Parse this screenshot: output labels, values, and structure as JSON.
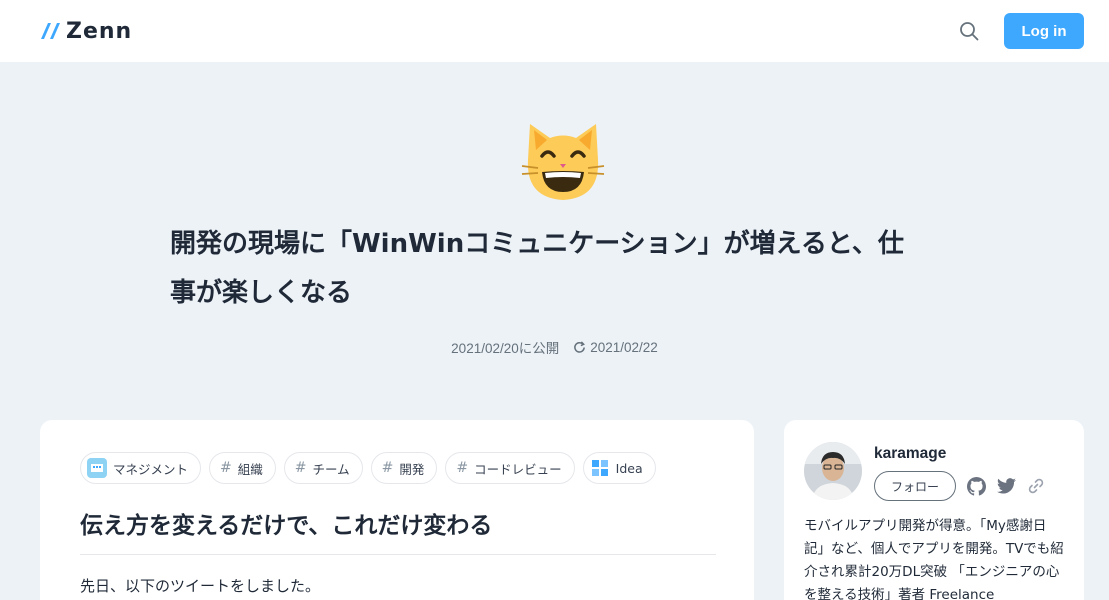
{
  "header": {
    "logo_text": "Zenn",
    "login_label": "Log in"
  },
  "article": {
    "emoji": "cat-face-with-smile",
    "title_line1": "開発の現場に「WinWinコミュニケーション」が増えると、仕",
    "title_line2": "事が楽しくなる",
    "published": "2021/02/20に公開",
    "updated": "2021/02/22",
    "topics": [
      {
        "label": "マネジメント",
        "icon": "management-icon"
      },
      {
        "label": "組織",
        "icon": "hash"
      },
      {
        "label": "チーム",
        "icon": "hash"
      },
      {
        "label": "開発",
        "icon": "hash"
      },
      {
        "label": "コードレビュー",
        "icon": "hash"
      },
      {
        "label": "Idea",
        "icon": "idea-icon"
      }
    ],
    "heading": "伝え方を変えるだけで、これだけ変わる",
    "body_first": "先日、以下のツイートをしました。"
  },
  "author": {
    "name": "karamage",
    "follow_label": "フォロー",
    "bio": "モバイルアプリ開発が得意。「My感謝日記」など、個人でアプリを開発。TVでも紹介され累計20万DL突破 「エンジニアの心を整える技術」著者 Freelance"
  },
  "colors": {
    "brand": "#3ea8ff",
    "background": "#edf2f7"
  }
}
